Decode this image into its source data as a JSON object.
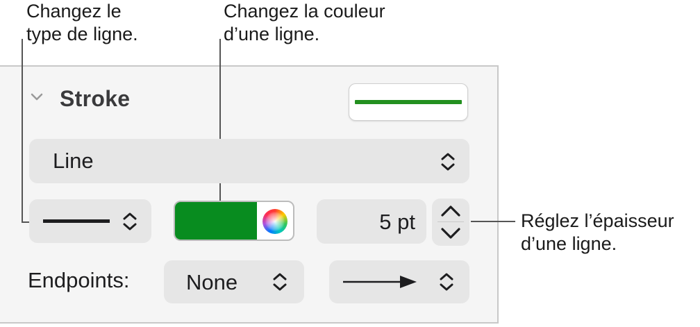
{
  "callouts": {
    "line_type": "Changez le\ntype de ligne.",
    "line_color": "Changez la couleur\nd’une ligne.",
    "line_thickness": "Réglez l’épaisseur\nd’une ligne."
  },
  "stroke_section": {
    "title": "Stroke",
    "preview_color": "#23901f",
    "line_style_value": "Line",
    "color_value": "#088c1f",
    "thickness_value": "5 pt",
    "endpoints_label": "Endpoints:",
    "start_endpoint_value": "None",
    "end_endpoint_icon": "arrow-right-icon"
  }
}
